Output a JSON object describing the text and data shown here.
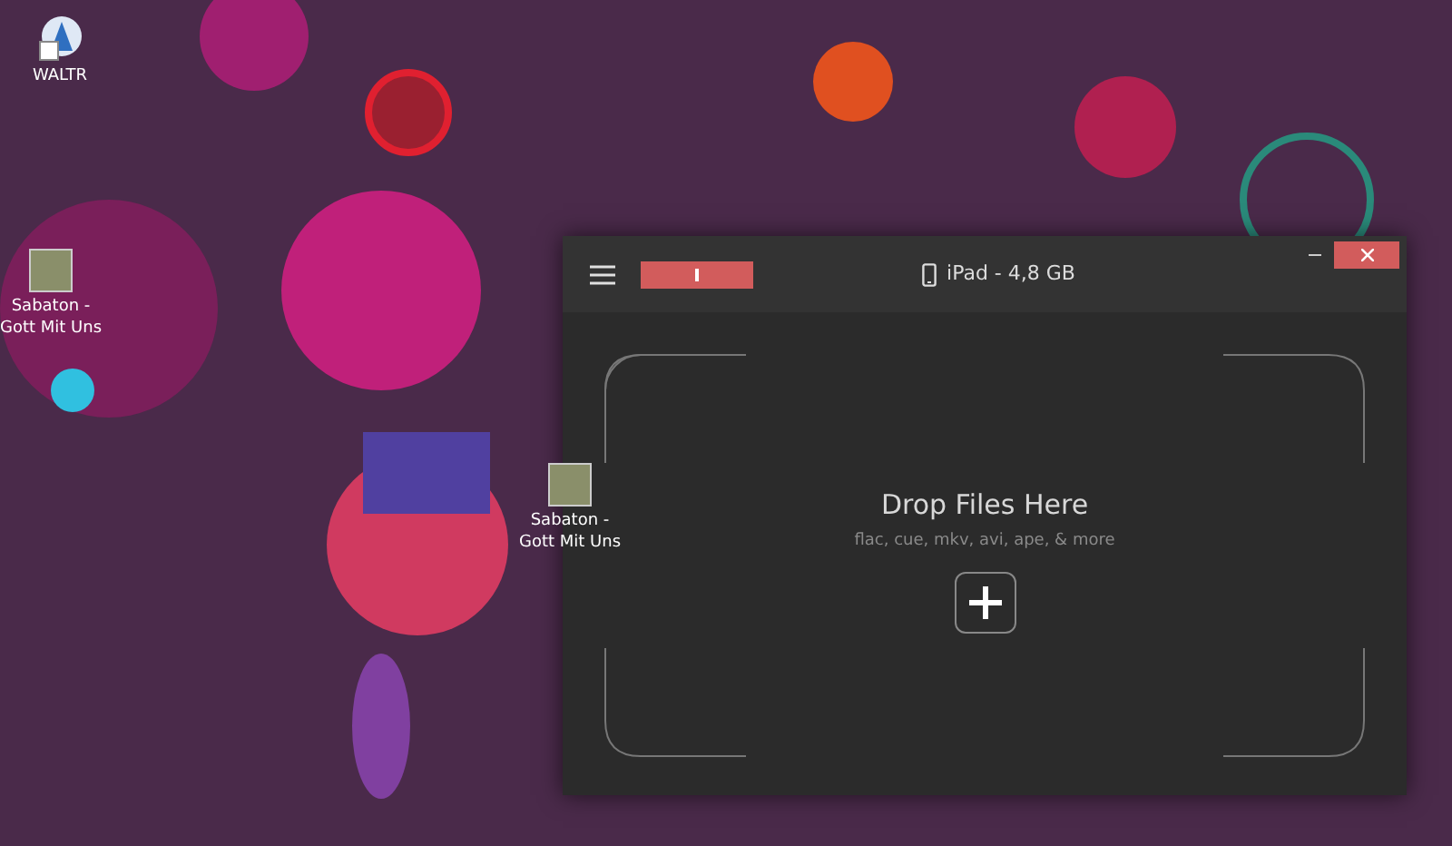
{
  "desktop": {
    "icons": [
      {
        "label": "WALTR",
        "kind": "app"
      },
      {
        "label": "Sabaton - Gott Mit Uns",
        "kind": "image"
      },
      {
        "label": "Sabaton - Gott Mit Uns",
        "kind": "image"
      }
    ]
  },
  "window": {
    "progress": {
      "level": 1
    },
    "device": "iPad - 4,8 GB",
    "drop_zone": {
      "title": "Drop Files Here",
      "subtitle": "flac, cue, mkv, avi, ape, & more"
    }
  }
}
